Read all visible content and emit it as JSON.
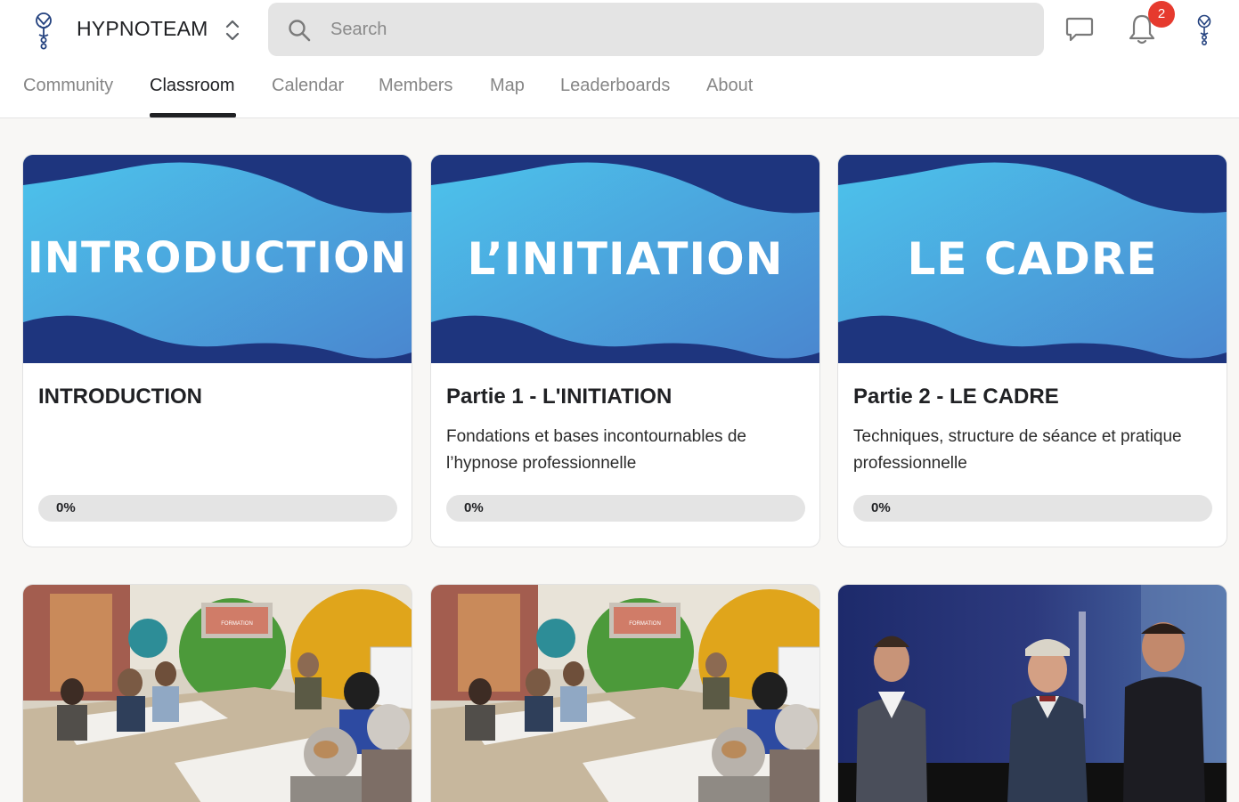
{
  "header": {
    "brand": "HYPNOTEAM",
    "search": {
      "placeholder": "Search",
      "value": ""
    },
    "notifications_count": "2",
    "colors": {
      "accent": "#202124",
      "badge": "#e63a2e",
      "brand_navy": "#1f3a7a"
    }
  },
  "tabs": [
    {
      "label": "Community",
      "active": false
    },
    {
      "label": "Classroom",
      "active": true
    },
    {
      "label": "Calendar",
      "active": false
    },
    {
      "label": "Members",
      "active": false
    },
    {
      "label": "Map",
      "active": false
    },
    {
      "label": "Leaderboards",
      "active": false
    },
    {
      "label": "About",
      "active": false
    }
  ],
  "courses": [
    {
      "banner_text": "INTRODUCTION",
      "title": "INTRODUCTION",
      "description": "",
      "progress_label": "0%",
      "progress": 0
    },
    {
      "banner_text": "L’INITIATION",
      "title": "Partie 1 - L'INITIATION",
      "description": "Fondations et bases incontournables de l’hypnose professionnelle",
      "progress_label": "0%",
      "progress": 0
    },
    {
      "banner_text": "LE CADRE",
      "title": "Partie 2 - LE CADRE",
      "description": "Techniques, structure de séance et pratique professionnelle",
      "progress_label": "0%",
      "progress": 0
    }
  ],
  "photos": [
    {
      "name": "classroom-photo",
      "banner": "FORMATION"
    },
    {
      "name": "classroom-photo",
      "banner": "FORMATION"
    },
    {
      "name": "stage-photo"
    }
  ]
}
